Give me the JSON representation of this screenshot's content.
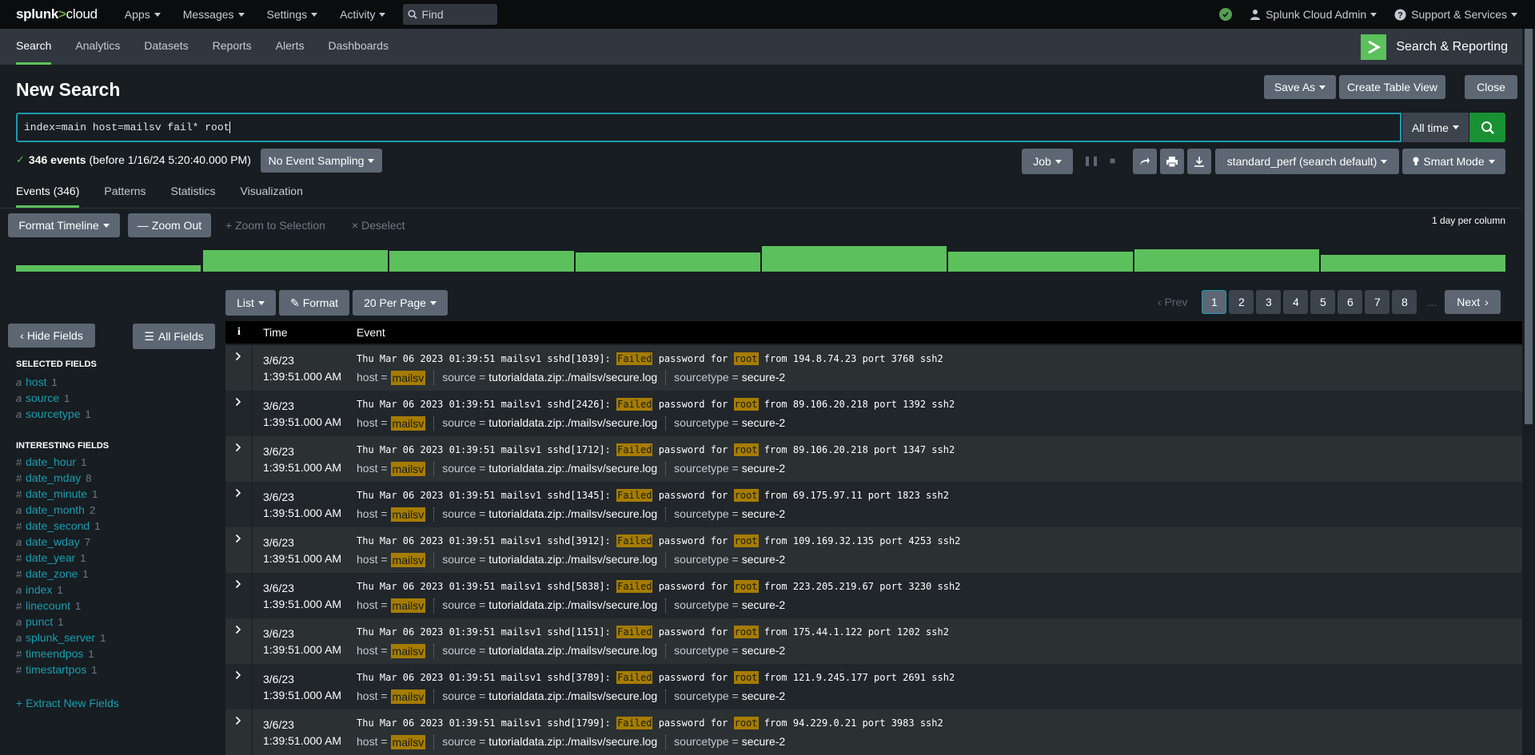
{
  "topbar": {
    "logo_prefix": "splunk",
    "logo_gt": ">",
    "logo_suffix": "cloud",
    "nav": [
      "Apps",
      "Messages",
      "Settings",
      "Activity"
    ],
    "find_placeholder": "Find",
    "user": "Splunk Cloud Admin",
    "support": "Support & Services"
  },
  "appnav": {
    "tabs": [
      "Search",
      "Analytics",
      "Datasets",
      "Reports",
      "Alerts",
      "Dashboards"
    ],
    "active": "Search",
    "app_name": "Search & Reporting"
  },
  "search": {
    "title": "New Search",
    "save_as": "Save As",
    "create_table_view": "Create Table View",
    "close": "Close",
    "query": "index=main host=mailsv fail* root",
    "time_range": "All time",
    "event_count": "346 events",
    "event_count_suffix": "(before 1/16/24 5:20:40.000 PM)",
    "sampling": "No Event Sampling",
    "job": "Job",
    "perf": "standard_perf (search default)",
    "mode": "Smart Mode"
  },
  "result_tabs": [
    "Events (346)",
    "Patterns",
    "Statistics",
    "Visualization"
  ],
  "timeline": {
    "format_timeline": "Format Timeline",
    "zoom_out": "Zoom Out",
    "zoom_to_selection": "Zoom to Selection",
    "deselect": "Deselect",
    "scale": "1 day per column",
    "bars": [
      0.25,
      0.85,
      0.8,
      0.75,
      1.0,
      0.78,
      0.88,
      0.65
    ]
  },
  "list_controls": {
    "list": "List",
    "format": "Format",
    "per_page": "20 Per Page",
    "prev": "Prev",
    "pages": [
      "1",
      "2",
      "3",
      "4",
      "5",
      "6",
      "7",
      "8"
    ],
    "ellipsis": "...",
    "next": "Next",
    "current_page": "1"
  },
  "sidebar": {
    "hide_fields": "Hide Fields",
    "all_fields": "All Fields",
    "selected_title": "SELECTED FIELDS",
    "selected": [
      {
        "type": "a",
        "name": "host",
        "count": "1"
      },
      {
        "type": "a",
        "name": "source",
        "count": "1"
      },
      {
        "type": "a",
        "name": "sourcetype",
        "count": "1"
      }
    ],
    "interesting_title": "INTERESTING FIELDS",
    "interesting": [
      {
        "type": "#",
        "name": "date_hour",
        "count": "1"
      },
      {
        "type": "#",
        "name": "date_mday",
        "count": "8"
      },
      {
        "type": "#",
        "name": "date_minute",
        "count": "1"
      },
      {
        "type": "a",
        "name": "date_month",
        "count": "2"
      },
      {
        "type": "#",
        "name": "date_second",
        "count": "1"
      },
      {
        "type": "a",
        "name": "date_wday",
        "count": "7"
      },
      {
        "type": "#",
        "name": "date_year",
        "count": "1"
      },
      {
        "type": "#",
        "name": "date_zone",
        "count": "1"
      },
      {
        "type": "a",
        "name": "index",
        "count": "1"
      },
      {
        "type": "#",
        "name": "linecount",
        "count": "1"
      },
      {
        "type": "a",
        "name": "punct",
        "count": "1"
      },
      {
        "type": "a",
        "name": "splunk_server",
        "count": "1"
      },
      {
        "type": "#",
        "name": "timeendpos",
        "count": "1"
      },
      {
        "type": "#",
        "name": "timestartpos",
        "count": "1"
      }
    ],
    "extract": "+ Extract New Fields"
  },
  "table": {
    "col_info": "i",
    "col_time": "Time",
    "col_event": "Event",
    "field_host": "host =",
    "field_source": "source =",
    "field_sourcetype": "sourcetype =",
    "rows": [
      {
        "date": "3/6/23",
        "time": "1:39:51.000 AM",
        "pre": "Thu Mar 06 2023 01:39:51 mailsv1 sshd[1039]: ",
        "w1": "Failed",
        "mid": " password for ",
        "w2": "root",
        "post": " from 194.8.74.23 port 3768 ssh2",
        "host": "mailsv",
        "source": "tutorialdata.zip:./mailsv/secure.log",
        "sourcetype": "secure-2"
      },
      {
        "date": "3/6/23",
        "time": "1:39:51.000 AM",
        "pre": "Thu Mar 06 2023 01:39:51 mailsv1 sshd[2426]: ",
        "w1": "Failed",
        "mid": " password for ",
        "w2": "root",
        "post": " from 89.106.20.218 port 1392 ssh2",
        "host": "mailsv",
        "source": "tutorialdata.zip:./mailsv/secure.log",
        "sourcetype": "secure-2"
      },
      {
        "date": "3/6/23",
        "time": "1:39:51.000 AM",
        "pre": "Thu Mar 06 2023 01:39:51 mailsv1 sshd[1712]: ",
        "w1": "Failed",
        "mid": " password for ",
        "w2": "root",
        "post": " from 89.106.20.218 port 1347 ssh2",
        "host": "mailsv",
        "source": "tutorialdata.zip:./mailsv/secure.log",
        "sourcetype": "secure-2"
      },
      {
        "date": "3/6/23",
        "time": "1:39:51.000 AM",
        "pre": "Thu Mar 06 2023 01:39:51 mailsv1 sshd[1345]: ",
        "w1": "Failed",
        "mid": " password for ",
        "w2": "root",
        "post": " from 69.175.97.11 port 1823 ssh2",
        "host": "mailsv",
        "source": "tutorialdata.zip:./mailsv/secure.log",
        "sourcetype": "secure-2"
      },
      {
        "date": "3/6/23",
        "time": "1:39:51.000 AM",
        "pre": "Thu Mar 06 2023 01:39:51 mailsv1 sshd[3912]: ",
        "w1": "Failed",
        "mid": " password for ",
        "w2": "root",
        "post": " from 109.169.32.135 port 4253 ssh2",
        "host": "mailsv",
        "source": "tutorialdata.zip:./mailsv/secure.log",
        "sourcetype": "secure-2"
      },
      {
        "date": "3/6/23",
        "time": "1:39:51.000 AM",
        "pre": "Thu Mar 06 2023 01:39:51 mailsv1 sshd[5838]: ",
        "w1": "Failed",
        "mid": " password for ",
        "w2": "root",
        "post": " from 223.205.219.67 port 3230 ssh2",
        "host": "mailsv",
        "source": "tutorialdata.zip:./mailsv/secure.log",
        "sourcetype": "secure-2"
      },
      {
        "date": "3/6/23",
        "time": "1:39:51.000 AM",
        "pre": "Thu Mar 06 2023 01:39:51 mailsv1 sshd[1151]: ",
        "w1": "Failed",
        "mid": " password for ",
        "w2": "root",
        "post": " from 175.44.1.122 port 1202 ssh2",
        "host": "mailsv",
        "source": "tutorialdata.zip:./mailsv/secure.log",
        "sourcetype": "secure-2"
      },
      {
        "date": "3/6/23",
        "time": "1:39:51.000 AM",
        "pre": "Thu Mar 06 2023 01:39:51 mailsv1 sshd[3789]: ",
        "w1": "Failed",
        "mid": " password for ",
        "w2": "root",
        "post": " from 121.9.245.177 port 2691 ssh2",
        "host": "mailsv",
        "source": "tutorialdata.zip:./mailsv/secure.log",
        "sourcetype": "secure-2"
      },
      {
        "date": "3/6/23",
        "time": "1:39:51.000 AM",
        "pre": "Thu Mar 06 2023 01:39:51 mailsv1 sshd[1799]: ",
        "w1": "Failed",
        "mid": " password for ",
        "w2": "root",
        "post": " from 94.229.0.21 port 3983 ssh2",
        "host": "mailsv",
        "source": "tutorialdata.zip:./mailsv/secure.log",
        "sourcetype": "secure-2"
      }
    ]
  },
  "colors": {
    "accent_green": "#5cc05c",
    "highlight": "#a67c00",
    "link": "#1a9cb0"
  }
}
